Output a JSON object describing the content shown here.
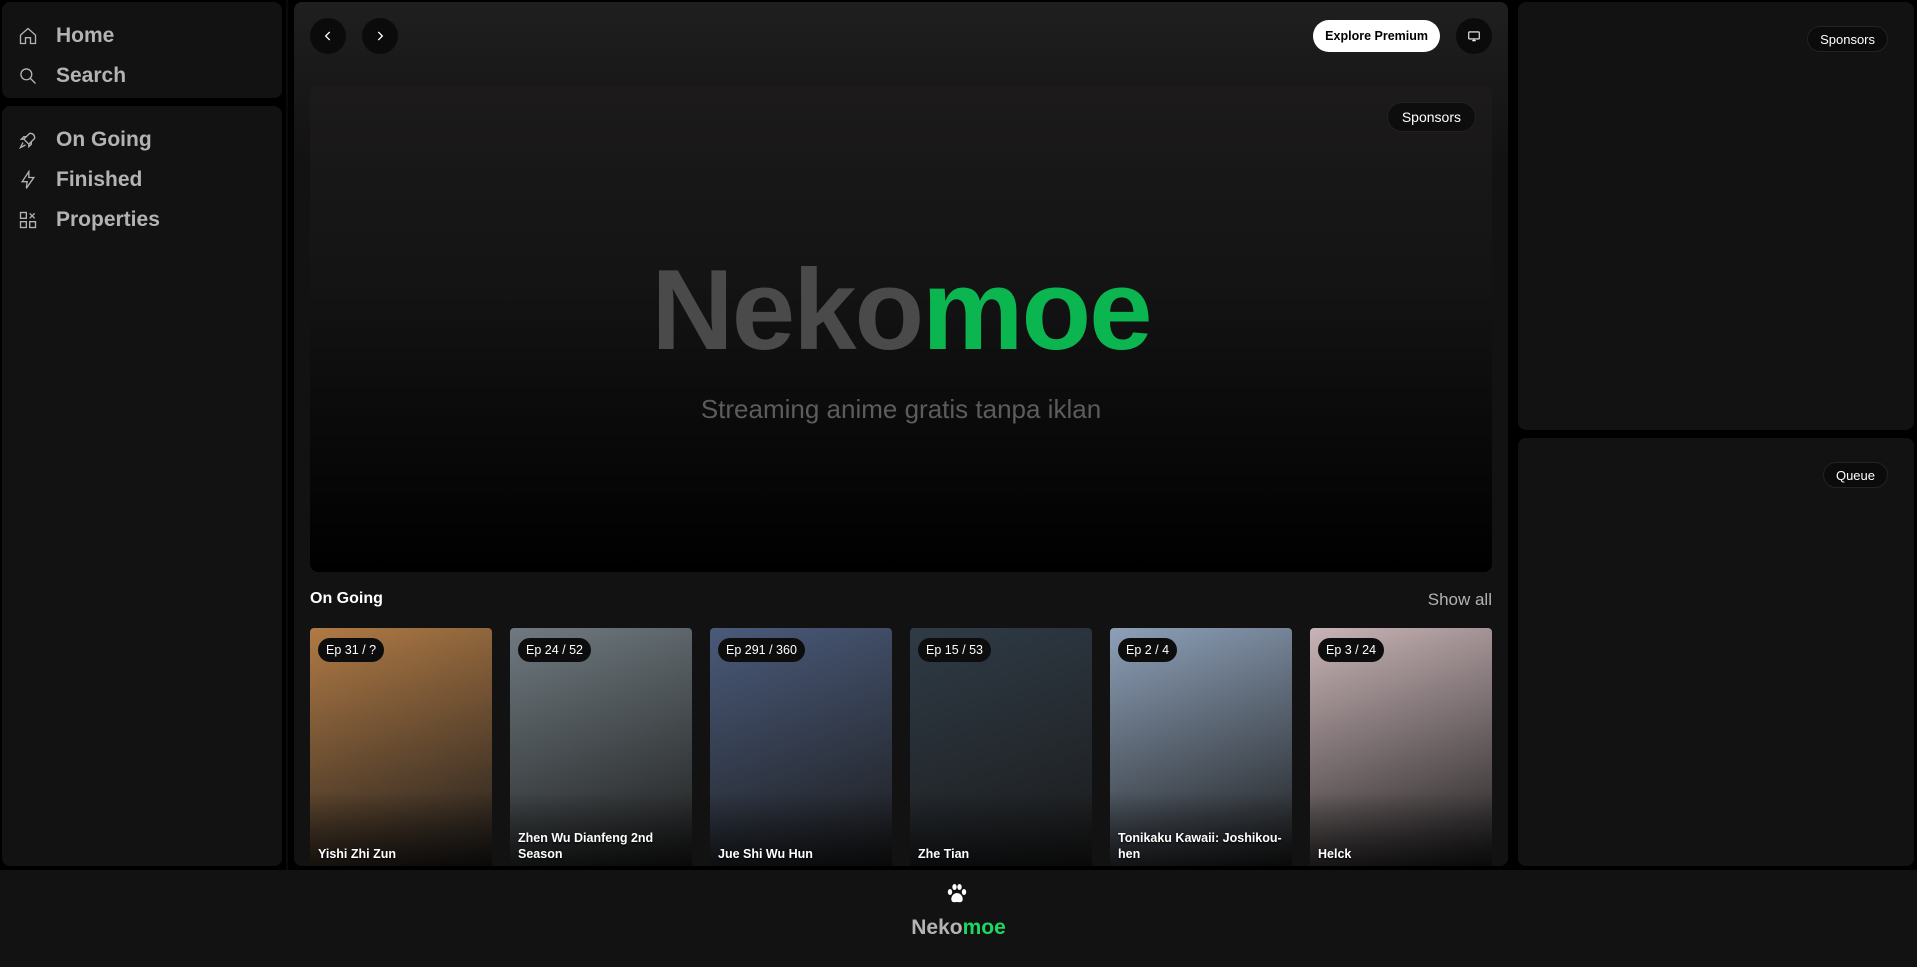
{
  "sidebar": {
    "top": [
      {
        "label": "Home",
        "icon": "home-icon"
      },
      {
        "label": "Search",
        "icon": "search-icon"
      }
    ],
    "library": [
      {
        "label": "On Going",
        "icon": "rocket-icon"
      },
      {
        "label": "Finished",
        "icon": "lightning-icon"
      },
      {
        "label": "Properties",
        "icon": "grid-icon"
      }
    ]
  },
  "topbar": {
    "back_icon": "chevron-left-icon",
    "forward_icon": "chevron-right-icon",
    "premium_label": "Explore Premium",
    "device_icon": "monitor-icon"
  },
  "hero": {
    "sponsor_label": "Sponsors",
    "logo_part1": "Neko",
    "logo_part2": "moe",
    "tagline": "Streaming anime gratis tanpa iklan",
    "accent": "#0bb550"
  },
  "ongoing": {
    "title": "On Going",
    "show_all": "Show all",
    "items": [
      {
        "episode": "Ep 31 / ?",
        "title": "Yishi Zhi Zun",
        "color": "#b07a45"
      },
      {
        "episode": "Ep 24 / 52",
        "title": "Zhen Wu Dianfeng 2nd Season",
        "color": "#6f7a80"
      },
      {
        "episode": "Ep 291 / 360",
        "title": "Jue Shi Wu Hun",
        "color": "#4a5a7a"
      },
      {
        "episode": "Ep 15 / 53",
        "title": "Zhe Tian",
        "color": "#2f3b46"
      },
      {
        "episode": "Ep 2 / 4",
        "title": "Tonikaku Kawaii: Joshikou-hen",
        "color": "#8da0b8"
      },
      {
        "episode": "Ep 3 / 24",
        "title": "Helck",
        "color": "#c9b4b7"
      }
    ]
  },
  "right_panels": {
    "sponsors_label": "Sponsors",
    "queue_label": "Queue"
  },
  "footer": {
    "icon": "paw-icon",
    "logo_part1": "Neko",
    "logo_part2": "moe"
  }
}
